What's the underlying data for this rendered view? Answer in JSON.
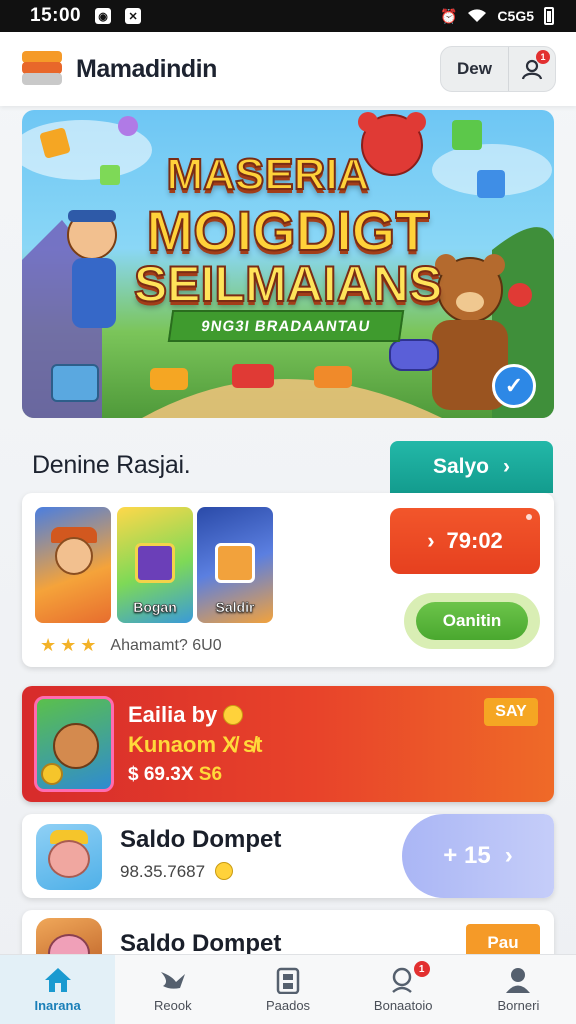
{
  "status_bar": {
    "time": "15:00",
    "icons_left": [
      "camera-icon",
      "close-icon"
    ],
    "network_text": "C5G5",
    "icons_right": [
      "alarm-icon",
      "wifi-icon",
      "battery-icon"
    ]
  },
  "app_bar": {
    "title": "Mamadindin",
    "action_button": "Dew",
    "user_badge": "1"
  },
  "banner": {
    "title_line1": "MASERIA",
    "title_line2": "MOIGDIGT",
    "title_line3": "SEILMAIANS",
    "ribbon_text": "9NG3I BRADAANTAU"
  },
  "section": {
    "title": "Denine Rasjai.",
    "action_label": "Salyo",
    "action_arrow": "›"
  },
  "featured_card": {
    "thumbnails": [
      {
        "label": ""
      },
      {
        "label": "Bogan"
      },
      {
        "label": "Saldir"
      }
    ],
    "stars": [
      "★",
      "★",
      "★"
    ],
    "rating_text": "Ahamamt? 6U0",
    "timer_arrow": "›",
    "timer_value": "79:02",
    "secondary_button": "Oanitin"
  },
  "offer_card": {
    "line1": "Eailia by",
    "line2": "Kunaom X̸ s̸t",
    "line3_amount": "$ 69.3X",
    "line3_suffix": "S6",
    "badge": "SAY"
  },
  "wallets": [
    {
      "title": "Saldo Dompet",
      "amount": "98.35.7687",
      "pill_value": "+ 15",
      "pill_arrow": "›"
    },
    {
      "title": "Saldo Dompet",
      "badge": "Pau"
    }
  ],
  "bottom_nav": [
    {
      "label": "Inarana",
      "icon": "home-icon",
      "active": true
    },
    {
      "label": "Reook",
      "icon": "bird-icon",
      "active": false
    },
    {
      "label": "Paados",
      "icon": "building-icon",
      "active": false
    },
    {
      "label": "Bonaatoio",
      "icon": "search-user-icon",
      "active": false,
      "badge": "1"
    },
    {
      "label": "Borneri",
      "icon": "profile-icon",
      "active": false
    }
  ],
  "colors": {
    "accent_teal": "#139c8e",
    "offer_red": "#d72b2b",
    "timer_orange": "#e6401f",
    "nav_active": "#1a7fb8"
  }
}
